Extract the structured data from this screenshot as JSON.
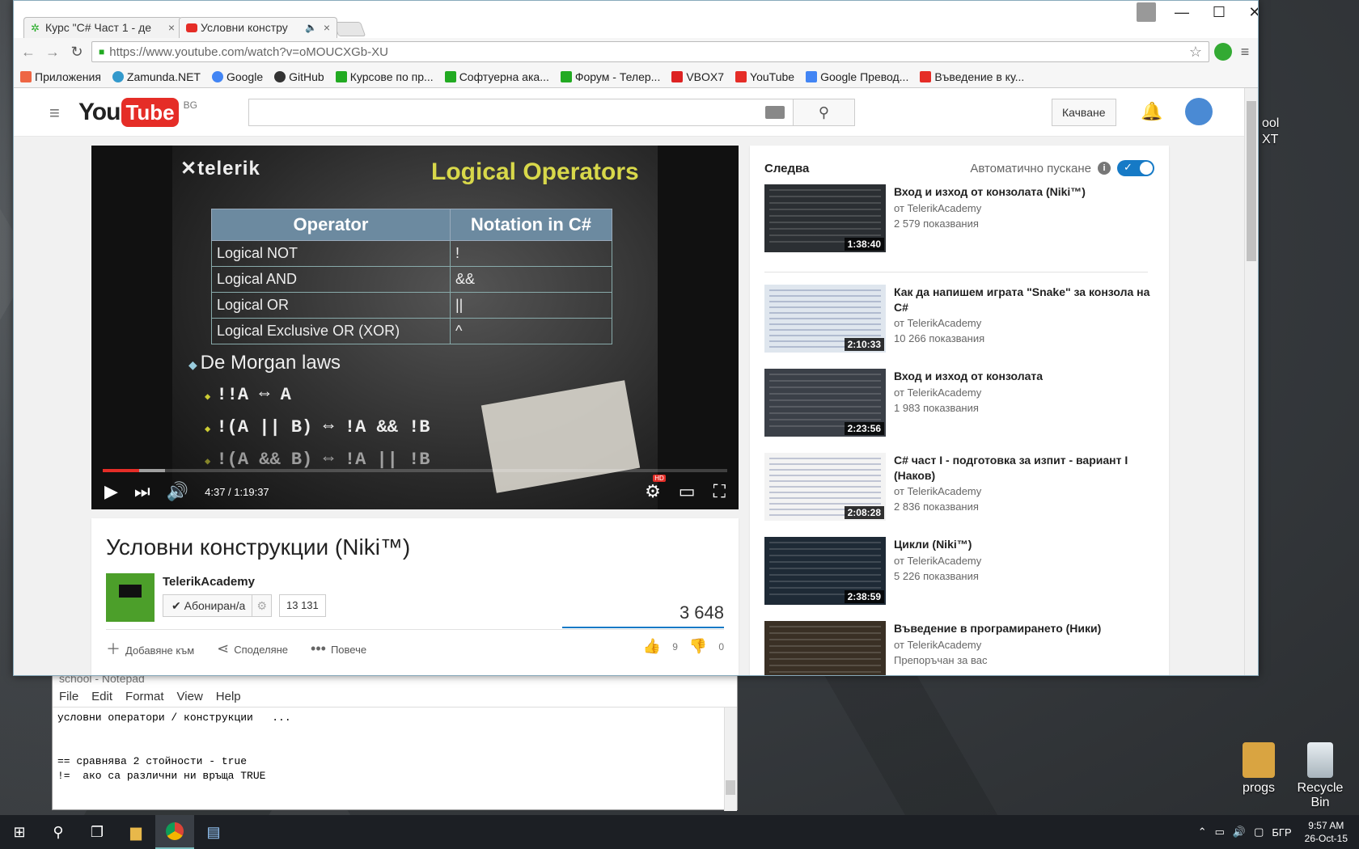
{
  "desktop": {
    "icons": [
      {
        "label": "progs"
      },
      {
        "label": "Recycle Bin"
      }
    ],
    "partial_labels": [
      "ool",
      "XT"
    ]
  },
  "notepad": {
    "title": "school - Notepad",
    "menu": [
      "File",
      "Edit",
      "Format",
      "View",
      "Help"
    ],
    "lines": [
      "условни оператори / конструкции   ...",
      "",
      "",
      "== сравнява 2 стойности - true",
      "!=  ако са различни ни връща TRUE"
    ]
  },
  "browser": {
    "tabs": [
      {
        "label": "Курс \"C# Част 1 - де",
        "close": "×"
      },
      {
        "label": "Условни констру",
        "close": "×"
      }
    ],
    "window_controls": {
      "minimize": "—",
      "maximize": "☐",
      "close": "✕"
    },
    "url": "https://www.youtube.com/watch?v=oMOUCXGb-XU",
    "bookmarks": [
      {
        "label": "Приложения",
        "color": "#e64"
      },
      {
        "label": "Zamunda.NET",
        "color": "#39c"
      },
      {
        "label": "Google",
        "color": "#4285f4"
      },
      {
        "label": "GitHub",
        "color": "#333"
      },
      {
        "label": "Курсове по пр...",
        "color": "#2a2"
      },
      {
        "label": "Софтуерна ака...",
        "color": "#2a2"
      },
      {
        "label": "Форум - Телер...",
        "color": "#2a2"
      },
      {
        "label": "VBOX7",
        "color": "#d22"
      },
      {
        "label": "YouTube",
        "color": "#e52d27"
      },
      {
        "label": "Google Превод...",
        "color": "#4285f4"
      },
      {
        "label": "Въведение в ку...",
        "color": "#e52d27"
      }
    ]
  },
  "youtube": {
    "logo": {
      "you": "You",
      "tube": "Tube",
      "country": "BG"
    },
    "upload_label": "Качване",
    "player": {
      "slide": {
        "brand": "telerik",
        "title": "Logical Operators",
        "headers": [
          "Operator",
          "Notation in C#"
        ],
        "rows": [
          [
            "Logical NOT",
            "!"
          ],
          [
            "Logical AND",
            "&&"
          ],
          [
            "Logical OR",
            "||"
          ],
          [
            "Logical Exclusive OR (XOR)",
            "^"
          ]
        ],
        "bullet": "De Morgan laws",
        "lines": [
          "!!A ⇔ A",
          "!(A || B) ⇔ !A && !B",
          "!(A && B) ⇔ !A || !B"
        ]
      },
      "time": "4:37 / 1:19:37",
      "played_fraction": 0.058,
      "buffered_fraction": 0.1
    },
    "video": {
      "title": "Условни конструкции (Niki™)",
      "channel": "TelerikAcademy",
      "subscribe_label": "Абониран/а",
      "subscriber_count": "13 131",
      "views": "3 648",
      "actions": [
        "Добавяне към",
        "Споделяне",
        "Повече"
      ],
      "likes": "9",
      "dislikes": "0"
    },
    "sidebar": {
      "next_label": "Следва",
      "autoplay_label": "Автоматично пускане",
      "videos": [
        {
          "title": "Вход и изход от конзолата (Niki™)",
          "channel": "от TelerikAcademy",
          "views": "2 579 показвания",
          "duration": "1:38:40"
        },
        {
          "title": "Как да напишем играта \"Snake\" за конзола на C#",
          "channel": "от TelerikAcademy",
          "views": "10 266 показвания",
          "duration": "2:10:33"
        },
        {
          "title": "Вход и изход от конзолата",
          "channel": "от TelerikAcademy",
          "views": "1 983 показвания",
          "duration": "2:23:56"
        },
        {
          "title": "C# част I - подготовка за изпит - вариант I (Наков)",
          "channel": "от TelerikAcademy",
          "views": "2 836 показвания",
          "duration": "2:08:28"
        },
        {
          "title": "Цикли (Niki™)",
          "channel": "от TelerikAcademy",
          "views": "5 226 показвания",
          "duration": "2:38:59"
        },
        {
          "title": "Въведение в програмирането (Ники)",
          "channel": "от TelerikAcademy",
          "views": "Препоръчан за вас",
          "duration": ""
        }
      ]
    }
  },
  "taskbar": {
    "lang": "БГР",
    "time": "9:57 AM",
    "date": "26-Oct-15"
  }
}
